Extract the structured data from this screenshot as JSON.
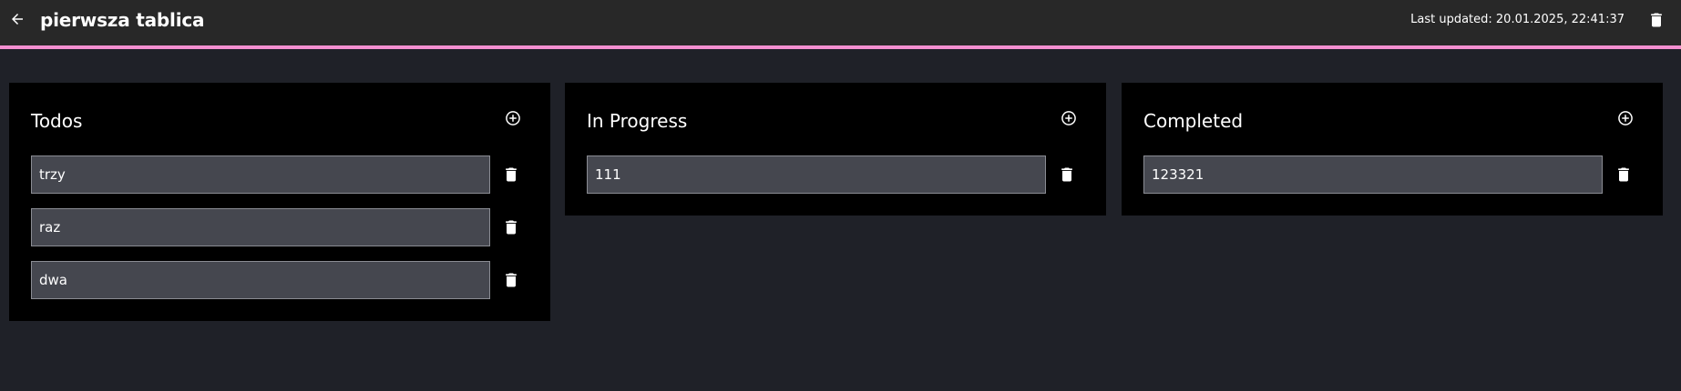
{
  "header": {
    "title": "pierwsza tablica",
    "last_updated": "Last updated: 20.01.2025, 22:41:37",
    "accent_color": "#f48fd0",
    "back_icon": "arrow-left-icon",
    "delete_icon": "trash-icon"
  },
  "columns": [
    {
      "title": "Todos",
      "add_icon": "plus-circle-icon",
      "tasks": [
        {
          "value": "trzy"
        },
        {
          "value": "raz"
        },
        {
          "value": "dwa"
        }
      ]
    },
    {
      "title": "In Progress",
      "add_icon": "plus-circle-icon",
      "tasks": [
        {
          "value": "111"
        }
      ]
    },
    {
      "title": "Completed",
      "add_icon": "plus-circle-icon",
      "tasks": [
        {
          "value": "123321"
        }
      ]
    }
  ]
}
